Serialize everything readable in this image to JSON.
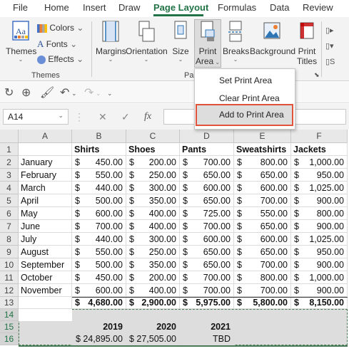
{
  "ribbon_tabs": [
    "File",
    "Home",
    "Insert",
    "Draw",
    "Page Layout",
    "Formulas",
    "Data",
    "Review"
  ],
  "active_tab": "Page Layout",
  "ribbon": {
    "themes": "Themes",
    "colors": "Colors",
    "fonts": "Fonts",
    "effects": "Effects",
    "themes_group": "Themes",
    "margins": "Margins",
    "orientation": "Orientation",
    "size": "Size",
    "print_area_1": "Print",
    "print_area_2": "Area",
    "breaks": "Breaks",
    "background": "Background",
    "print_titles_1": "Print",
    "print_titles_2": "Titles",
    "page_group_partial": "Pa"
  },
  "menu": {
    "set": "Set Print Area",
    "clear": "Clear Print Area",
    "add": "Add to Print Area"
  },
  "name_box": "A14",
  "formula_symbol": "fx",
  "columns": [
    "A",
    "B",
    "C",
    "D",
    "E",
    "F"
  ],
  "rows": [
    "1",
    "2",
    "3",
    "4",
    "5",
    "6",
    "7",
    "8",
    "9",
    "10",
    "11",
    "12",
    "13",
    "14",
    "15",
    "16"
  ],
  "headers": [
    "Shirts",
    "Shoes",
    "Pants",
    "Sweatshirts",
    "Jackets"
  ],
  "months": [
    "January",
    "February",
    "March",
    "April",
    "May",
    "June",
    "July",
    "August",
    "September",
    "October",
    "November"
  ],
  "values": [
    [
      "450.00",
      "200.00",
      "700.00",
      "800.00",
      "1,000.00"
    ],
    [
      "550.00",
      "250.00",
      "650.00",
      "650.00",
      "950.00"
    ],
    [
      "440.00",
      "300.00",
      "600.00",
      "600.00",
      "1,025.00"
    ],
    [
      "500.00",
      "350.00",
      "650.00",
      "700.00",
      "900.00"
    ],
    [
      "600.00",
      "400.00",
      "725.00",
      "550.00",
      "800.00"
    ],
    [
      "700.00",
      "400.00",
      "700.00",
      "650.00",
      "900.00"
    ],
    [
      "440.00",
      "300.00",
      "600.00",
      "600.00",
      "1,025.00"
    ],
    [
      "550.00",
      "250.00",
      "650.00",
      "650.00",
      "950.00"
    ],
    [
      "500.00",
      "350.00",
      "650.00",
      "700.00",
      "900.00"
    ],
    [
      "450.00",
      "200.00",
      "700.00",
      "800.00",
      "1,000.00"
    ],
    [
      "600.00",
      "400.00",
      "700.00",
      "700.00",
      "900.00"
    ]
  ],
  "totals": [
    "4,680.00",
    "2,900.00",
    "5,975.00",
    "5,800.00",
    "8,150.00"
  ],
  "currency": "$",
  "years": [
    "2019",
    "2020",
    "2021"
  ],
  "year_totals": [
    "$ 24,895.00",
    "$ 27,505.00",
    "TBD"
  ]
}
